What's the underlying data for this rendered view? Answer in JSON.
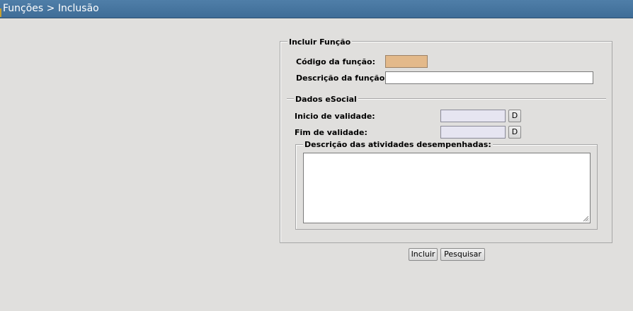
{
  "header": {
    "title": "Funções > Inclusão"
  },
  "form": {
    "legend": "Incluir Função",
    "codigo_label": "Código da função:",
    "codigo_value": "",
    "descricao_label": "Descrição da função:",
    "descricao_value": "",
    "esocial": {
      "legend": "Dados eSocial",
      "inicio_label": "Inicio de validade:",
      "inicio_value": "",
      "inicio_button": "D",
      "fim_label": "Fim de validade:",
      "fim_value": "",
      "fim_button": "D",
      "atividades_legend": "Descrição das atividades desempenhadas:",
      "atividades_value": ""
    }
  },
  "actions": {
    "incluir": "Incluir",
    "pesquisar": "Pesquisar"
  },
  "colors": {
    "header_bg": "#4a7aa4",
    "codigo_field_bg": "#e3b98a",
    "date_field_bg": "#e6e5f1",
    "page_bg": "#e0dfdd"
  }
}
